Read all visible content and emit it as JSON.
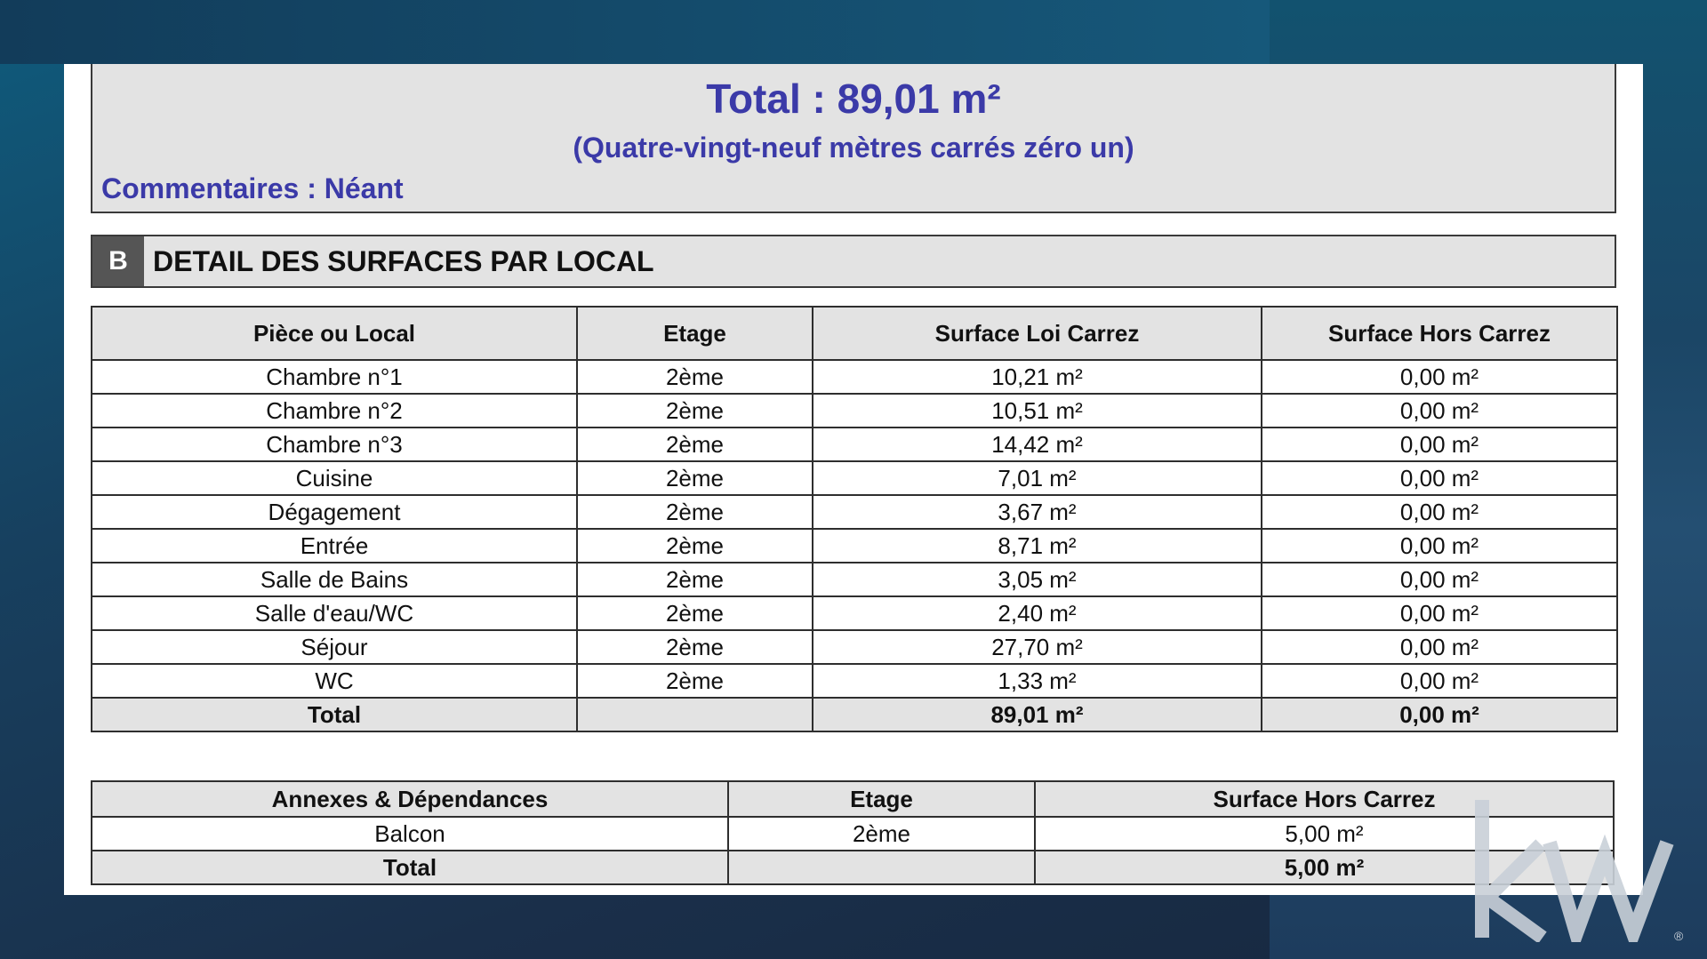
{
  "summary": {
    "total": "Total : 89,01 m²",
    "total_words": "(Quatre-vingt-neuf mètres carrés zéro un)",
    "comments": "Commentaires : Néant"
  },
  "section": {
    "letter": "B",
    "title": "DETAIL DES SURFACES PAR LOCAL"
  },
  "rooms_table": {
    "headers": [
      "Pièce ou Local",
      "Etage",
      "Surface Loi Carrez",
      "Surface Hors Carrez"
    ],
    "rows": [
      [
        "Chambre n°1",
        "2ème",
        "10,21 m²",
        "0,00 m²"
      ],
      [
        "Chambre n°2",
        "2ème",
        "10,51 m²",
        "0,00 m²"
      ],
      [
        "Chambre n°3",
        "2ème",
        "14,42 m²",
        "0,00 m²"
      ],
      [
        "Cuisine",
        "2ème",
        "7,01 m²",
        "0,00 m²"
      ],
      [
        "Dégagement",
        "2ème",
        "3,67 m²",
        "0,00 m²"
      ],
      [
        "Entrée",
        "2ème",
        "8,71 m²",
        "0,00 m²"
      ],
      [
        "Salle de Bains",
        "2ème",
        "3,05 m²",
        "0,00 m²"
      ],
      [
        "Salle d'eau/WC",
        "2ème",
        "2,40 m²",
        "0,00 m²"
      ],
      [
        "Séjour",
        "2ème",
        "27,70 m²",
        "0,00 m²"
      ],
      [
        "WC",
        "2ème",
        "1,33 m²",
        "0,00 m²"
      ]
    ],
    "total": [
      "Total",
      "",
      "89,01 m²",
      "0,00 m²"
    ]
  },
  "annex_table": {
    "headers": [
      "Annexes & Dépendances",
      "Etage",
      "Surface Hors Carrez"
    ],
    "rows": [
      [
        "Balcon",
        "2ème",
        "5,00 m²"
      ]
    ],
    "total": [
      "Total",
      "",
      "5,00 m²"
    ]
  },
  "logo": {
    "text": "kw",
    "registered": "®",
    "color": "#c9d0d8"
  }
}
